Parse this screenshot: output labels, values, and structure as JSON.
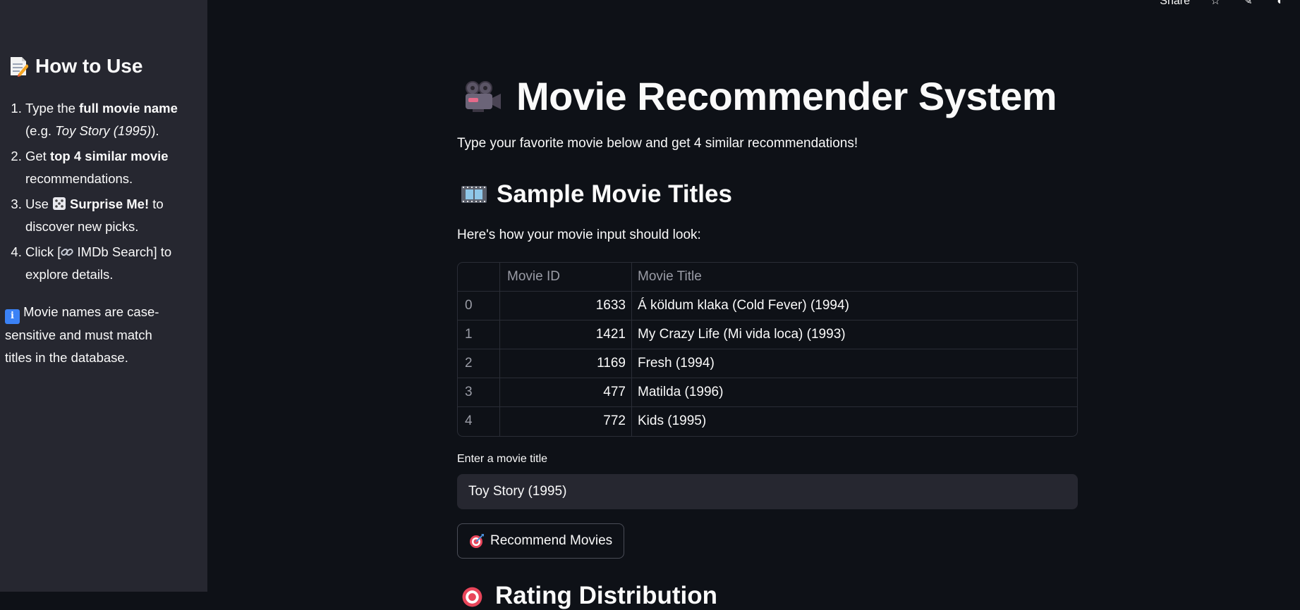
{
  "topbar": {
    "share_label": "Share",
    "star_icon": "star-icon",
    "edit_icon": "pencil-icon",
    "github_icon": "github-icon"
  },
  "sidebar": {
    "title_icon": "memo-icon",
    "title": "How to Use",
    "items": [
      {
        "prefix": "Type the ",
        "bold": "full movie name",
        "suffix": " (e.g. ",
        "italic": "Toy Story (1995)",
        "tail": ")."
      },
      {
        "prefix": "Get ",
        "bold": "top 4 similar movie",
        "suffix": " recommendations."
      },
      {
        "prefix": "Use ",
        "icon": "die-icon",
        "bold": "Surprise Me!",
        "suffix": " to discover new picks."
      },
      {
        "prefix": "Click [",
        "icon": "link-icon",
        "text": " IMDb Search] to explore details."
      }
    ],
    "note_icon": "info-icon",
    "note": " Movie names are case-sensitive and must match titles in the database."
  },
  "main": {
    "title_icon": "movie-camera-icon",
    "title": "Movie Recommender System",
    "subtitle": "Type your favorite movie below and get 4 similar recommendations!",
    "section_icon": "film-frames-icon",
    "section_title": "Sample Movie Titles",
    "section_text": "Here's how your movie input should look:",
    "table": {
      "columns": [
        "",
        "Movie ID",
        "Movie Title"
      ],
      "rows": [
        {
          "index": "0",
          "id": "1633",
          "title": "Á köldum klaka (Cold Fever) (1994)"
        },
        {
          "index": "1",
          "id": "1421",
          "title": "My Crazy Life (Mi vida loca) (1993)"
        },
        {
          "index": "2",
          "id": "1169",
          "title": "Fresh (1994)"
        },
        {
          "index": "3",
          "id": "477",
          "title": "Matilda (1996)"
        },
        {
          "index": "4",
          "id": "772",
          "title": "Kids (1995)"
        }
      ]
    },
    "input_label": "Enter a movie title",
    "input_value": "Toy Story (1995)",
    "button_icon": "direct-hit-icon",
    "button_label": "Recommend Movies",
    "next_section_icon": "direct-hit-icon",
    "next_section_title": "Rating Distribution"
  },
  "colors": {
    "background": "#0e1117",
    "sidebar": "#262730",
    "text": "#fafafa",
    "muted": "#9a9ca6",
    "border": "#2a2d36"
  }
}
